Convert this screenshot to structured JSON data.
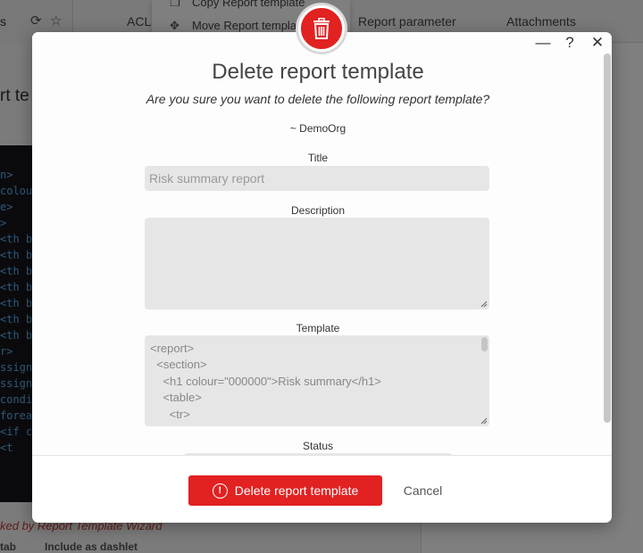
{
  "background": {
    "left_tab_text": "s",
    "tabs": [
      "ACLs",
      "Report parameter",
      "Attachments"
    ],
    "menu": {
      "items": [
        {
          "label": "Copy Report template",
          "icon": "copy-icon"
        },
        {
          "label": "Move Report template",
          "icon": "move-icon"
        }
      ]
    },
    "heading": "rt te",
    "code_lines": [
      "n>",
      "colour",
      "e>",
      ">",
      "<th bo",
      "<th bo",
      "<th bo",
      "<th bo",
      "<th bo",
      "<th bo",
      "<th bo",
      "r>",
      "ssign",
      "ssign",
      "condi",
      "forea",
      "  <if c",
      "    <t"
    ],
    "note": "ked by Report Template Wizard",
    "footer_labels": [
      "tab",
      "Include as dashlet"
    ]
  },
  "modal": {
    "title": "Delete report template",
    "question": "Are you sure you want to delete the following report template?",
    "org": "~ DemoOrg",
    "window_controls": {
      "minimize": "—",
      "help": "?",
      "close": "✕"
    },
    "fields": {
      "title_label": "Title",
      "title_value": "Risk summary report",
      "description_label": "Description",
      "description_value": "",
      "template_label": "Template",
      "template_lines": [
        "<report>",
        "  <section>",
        "    <h1 colour=\"000000\">Risk summary</h1>",
        "    <table>",
        "      <tr>"
      ],
      "status_label": "Status"
    },
    "buttons": {
      "delete_label": "Delete report template",
      "cancel_label": "Cancel"
    },
    "colors": {
      "danger": "#e22121",
      "overlay": "rgba(0,0,0,0.5)"
    }
  }
}
